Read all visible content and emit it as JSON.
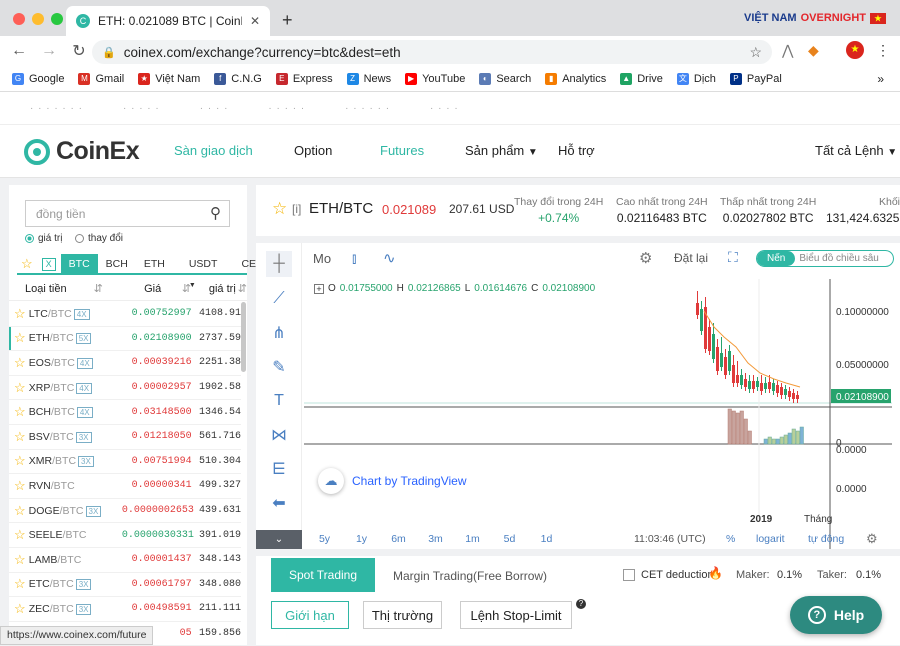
{
  "browser": {
    "tab_title": "ETH: 0.021089 BTC | CoinEx -",
    "new_tab": "+",
    "url": "coinex.com/exchange?currency=btc&dest=eth",
    "vietnam_badge_1": "VIỆT NAM",
    "vietnam_badge_2": "OVERNIGHT",
    "status_url": "https://www.coinex.com/future"
  },
  "bookmarks": [
    {
      "label": "Google",
      "icon": "G",
      "color": "#4285f4"
    },
    {
      "label": "Gmail",
      "icon": "M",
      "color": "#d93025"
    },
    {
      "label": "Việt Nam",
      "icon": "★",
      "color": "#da251d"
    },
    {
      "label": "C.N.G",
      "icon": "f",
      "color": "#3b5998"
    },
    {
      "label": "Express",
      "icon": "E",
      "color": "#c6282e"
    },
    {
      "label": "News",
      "icon": "Z",
      "color": "#1e88e5"
    },
    {
      "label": "YouTube",
      "icon": "▶",
      "color": "#ff0000"
    },
    {
      "label": "Search",
      "icon": "◐",
      "color": "#5b7bb5"
    },
    {
      "label": "Analytics",
      "icon": "▮",
      "color": "#f57c00"
    },
    {
      "label": "Drive",
      "icon": "▲",
      "color": "#1fa463"
    },
    {
      "label": "Dịch",
      "icon": "文",
      "color": "#4285f4"
    },
    {
      "label": "PayPal",
      "icon": "P",
      "color": "#003087"
    }
  ],
  "header": {
    "logo": "CoinEx",
    "nav": [
      "Sàn giao dịch",
      "Option",
      "Futures",
      "Sản phẩm",
      "Hỗ trợ"
    ],
    "all_orders": "Tất cả Lệnh"
  },
  "market": {
    "search_placeholder": "đồng tiền",
    "radio_price": "giá trị",
    "radio_change": "thay đổi",
    "tabs": [
      "BTC",
      "BCH",
      "ETH",
      "USDT",
      "CET"
    ],
    "col_pair": "Loại tiền",
    "col_price": "Giá",
    "col_volume": "giá trị",
    "rows": [
      {
        "base": "LTC",
        "quote": "/BTC",
        "lev": "4X",
        "price": "0.00752997",
        "up": true,
        "vol": "4108.91"
      },
      {
        "base": "ETH",
        "quote": "/BTC",
        "lev": "5X",
        "price": "0.02108900",
        "up": true,
        "vol": "2737.59"
      },
      {
        "base": "EOS",
        "quote": "/BTC",
        "lev": "4X",
        "price": "0.00039216",
        "up": false,
        "vol": "2251.38"
      },
      {
        "base": "XRP",
        "quote": "/BTC",
        "lev": "4X",
        "price": "0.00002957",
        "up": false,
        "vol": "1902.58"
      },
      {
        "base": "BCH",
        "quote": "/BTC",
        "lev": "4X",
        "price": "0.03148500",
        "up": false,
        "vol": "1346.54"
      },
      {
        "base": "BSV",
        "quote": "/BTC",
        "lev": "3X",
        "price": "0.01218050",
        "up": false,
        "vol": "561.716"
      },
      {
        "base": "XMR",
        "quote": "/BTC",
        "lev": "3X",
        "price": "0.00751994",
        "up": false,
        "vol": "510.304"
      },
      {
        "base": "RVN",
        "quote": "/BTC",
        "lev": "",
        "price": "0.00000341",
        "up": false,
        "vol": "499.327"
      },
      {
        "base": "DOGE",
        "quote": "/BTC",
        "lev": "3X",
        "price": "0.0000002653",
        "up": false,
        "vol": "439.631"
      },
      {
        "base": "SEELE",
        "quote": "/BTC",
        "lev": "",
        "price": "0.0000030331",
        "up": true,
        "vol": "391.019"
      },
      {
        "base": "LAMB",
        "quote": "/BTC",
        "lev": "",
        "price": "0.00001437",
        "up": false,
        "vol": "348.143"
      },
      {
        "base": "ETC",
        "quote": "/BTC",
        "lev": "3X",
        "price": "0.00061797",
        "up": false,
        "vol": "348.080"
      },
      {
        "base": "ZEC",
        "quote": "/BTC",
        "lev": "3X",
        "price": "0.00498591",
        "up": false,
        "vol": "211.111"
      },
      {
        "base": "",
        "quote": "",
        "lev": "",
        "price": "05",
        "up": false,
        "vol": "159.856"
      }
    ]
  },
  "ticker": {
    "bracket": "[i]",
    "pair": "ETH/BTC",
    "price": "0.021089",
    "usd": "207.61 USD",
    "change_label": "Thay đổi trong 24H",
    "change_value": "+0.74%",
    "high_label": "Cao nhất trong 24H",
    "high_value": "0.02116483 BTC",
    "low_label": "Thấp nhất trong 24H",
    "low_value": "0.02027802 BTC",
    "vol_label": "Khối",
    "vol_value": "131,424.6325"
  },
  "chart": {
    "interval": "Mo",
    "reset": "Đặt lại",
    "mode_on": "Nến",
    "mode_off": "Biểu đồ chiều sâu",
    "ohlc": {
      "o_label": "O",
      "o": "0.01755000",
      "h_label": "H",
      "h": "0.02126865",
      "l_label": "L",
      "l": "0.01614676",
      "c_label": "C",
      "c": "0.02108900"
    },
    "price_ticks": [
      "0.10000000",
      "0.05000000"
    ],
    "last_price": "0.02108900",
    "vol_ticks": [
      "0",
      "0.0000",
      "0.0000"
    ],
    "year_label": "2019",
    "month_label": "Tháng",
    "attribution": "Chart by TradingView",
    "ranges": [
      "5y",
      "1y",
      "6m",
      "3m",
      "1m",
      "5d",
      "1d"
    ],
    "time": "11:03:46 (UTC)",
    "pct": "%",
    "log": "logarit",
    "auto": "tự động"
  },
  "orders": {
    "tab_spot": "Spot Trading",
    "tab_margin": "Margin Trading(Free Borrow)",
    "cet_deduction": "CET deduction",
    "maker": "Maker:",
    "maker_value": "0.1%",
    "taker": "Taker:",
    "taker_value": "0.1%",
    "type_limit": "Giới hạn",
    "type_market": "Thị trường",
    "type_stop": "Lệnh Stop-Limit",
    "help": "Help"
  },
  "colors": {
    "accent": "#2fb7a4",
    "up": "#27a36d",
    "down": "#e03a3a"
  }
}
